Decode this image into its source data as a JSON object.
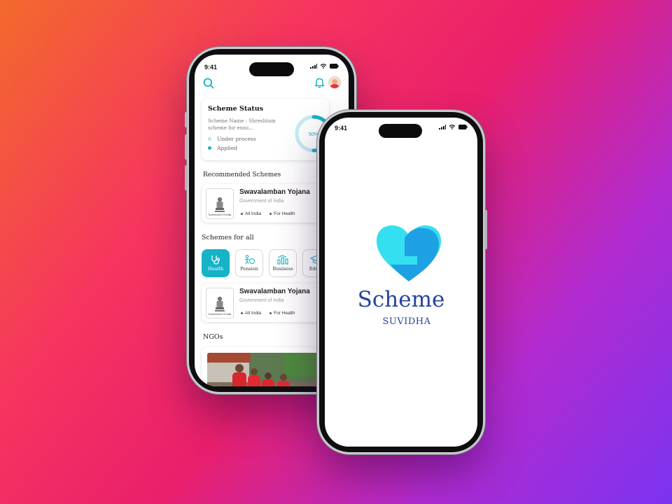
{
  "back_phone": {
    "status_time": "9:41",
    "status_card": {
      "title": "Scheme Status",
      "scheme_name": "Scheme Name : Shreshtam scheme for ensu...",
      "legend": [
        "Under process",
        "Applied"
      ],
      "progress_label": "50%",
      "progress_fraction": 0.5
    },
    "recommended": {
      "heading": "Recommended Schemes",
      "card": {
        "title": "Swavalamban Yojana",
        "subtitle": "Government of India",
        "emblem_caption": "Government Of India",
        "tags": [
          "All India",
          "For Health"
        ]
      }
    },
    "schemes_for_all": {
      "heading": "Schemes for all",
      "categories": [
        "Health",
        "Pension",
        "Business",
        "Educa"
      ],
      "card": {
        "title": "Swavalamban Yojana",
        "subtitle": "Government of India",
        "emblem_caption": "Government Of India",
        "tags": [
          "All India",
          "For Health"
        ]
      }
    },
    "ngos": {
      "heading": "NGOs"
    }
  },
  "front_phone": {
    "status_time": "9:41",
    "logo": {
      "title": "Scheme",
      "subtitle": "SUVIDHA"
    }
  },
  "colors": {
    "accent": "#14b3c8",
    "logo_light": "#34e0f0",
    "logo_dark": "#1ea0e4",
    "logo_text": "#24459c"
  },
  "icons": [
    "search-icon",
    "bell-icon",
    "avatar",
    "stethoscope-icon",
    "pension-icon",
    "business-icon",
    "education-icon",
    "emblem-icon"
  ]
}
